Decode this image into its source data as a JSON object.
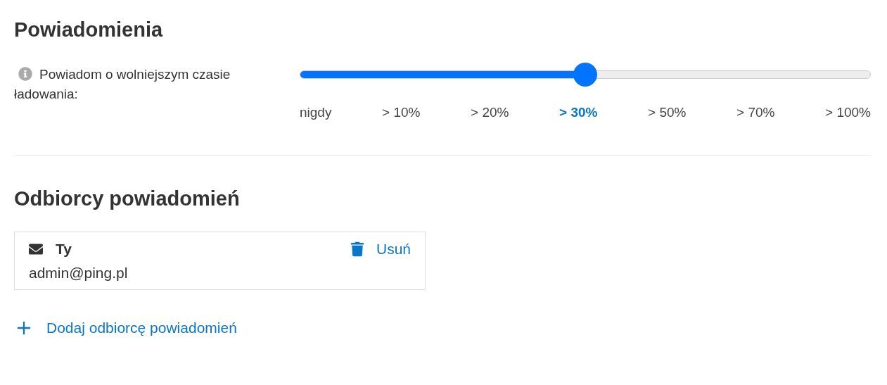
{
  "sections": [
    {
      "title": "Powiadomienia"
    },
    {
      "title": "Odbiorcy powiadomień"
    }
  ],
  "slowdown": {
    "label": "Powiadom o wolniejszym czasie ładowania:",
    "level": 0.5,
    "options": [
      {
        "label": "nigdy",
        "selected": false
      },
      {
        "label": "> 10%",
        "selected": false
      },
      {
        "label": "> 20%",
        "selected": false
      },
      {
        "label": "> 30%",
        "selected": true
      },
      {
        "label": "> 50%",
        "selected": false
      },
      {
        "label": "> 70%",
        "selected": false
      },
      {
        "label": "> 100%",
        "selected": false
      }
    ]
  },
  "recipients": [
    {
      "name": "Ty",
      "email": "admin@ping.pl",
      "action": "Usuń"
    }
  ],
  "add_link": "Dodaj odbiorcę powiadomień"
}
